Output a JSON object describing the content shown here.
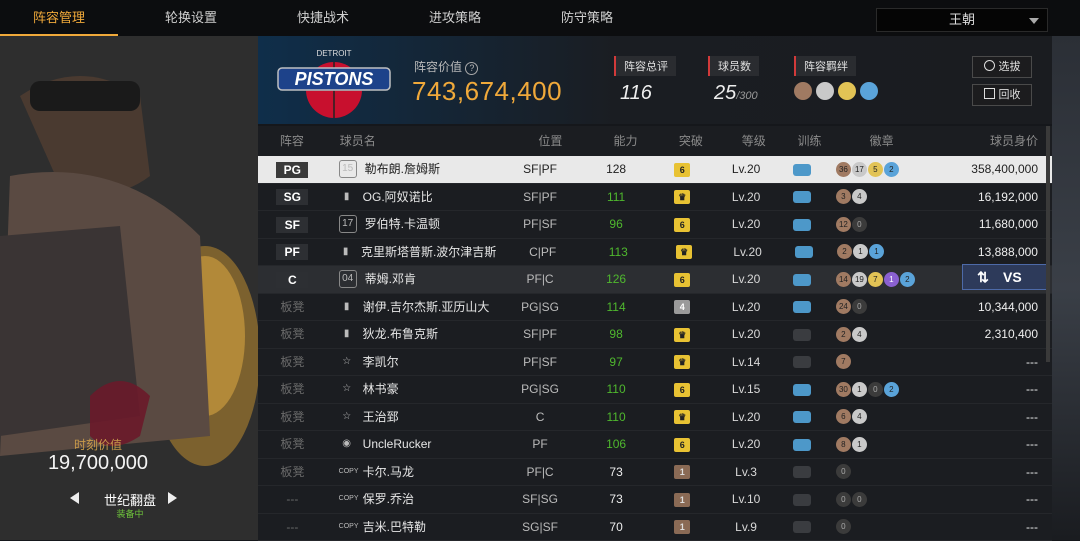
{
  "nav": {
    "tabs": [
      "阵容管理",
      "轮换设置",
      "快捷战术",
      "进攻策略",
      "防守策略"
    ],
    "team": "王朝"
  },
  "card": {
    "value_label": "时刻价值",
    "value": "19,700,000",
    "name": "世纪翻盘",
    "status": "装备中"
  },
  "header": {
    "lineup_value_label": "阵容价值",
    "lineup_value": "743,674,400",
    "overall_label": "阵容总评",
    "overall": "116",
    "players_label": "球员数",
    "players": "25",
    "players_max": "/300",
    "bond_label": "阵容羁绊",
    "select_btn": "选拔",
    "recycle_btn": "回收"
  },
  "columns": [
    "阵容",
    "球员名",
    "位置",
    "能力",
    "突破",
    "等级",
    "训练",
    "徽章",
    "球员身价"
  ],
  "rows": [
    {
      "slot": "PG",
      "icon": "15",
      "name": "勒布朗.詹姆斯",
      "pos": "SF|PF",
      "ability": "128",
      "abilColor": "white",
      "brk": "6",
      "brkType": "y",
      "lvl": "Lv.20",
      "train": "blue",
      "badges": [
        [
          "36",
          "br"
        ],
        [
          "17",
          "si"
        ],
        [
          "5",
          "go"
        ],
        [
          "2",
          "bl"
        ]
      ],
      "price": "358,400,000"
    },
    {
      "slot": "SG",
      "icon": "signal",
      "name": "OG.阿奴诺比",
      "pos": "SF|PF",
      "ability": "111",
      "abilColor": "green",
      "brk": "crown",
      "brkType": "y",
      "lvl": "Lv.20",
      "train": "blue",
      "badges": [
        [
          "3",
          "br"
        ],
        [
          "4",
          "si"
        ]
      ],
      "price": "16,192,000"
    },
    {
      "slot": "SF",
      "icon": "17",
      "name": "罗伯特.卡温顿",
      "pos": "PF|SF",
      "ability": "96",
      "abilColor": "green",
      "brk": "6",
      "brkType": "y",
      "lvl": "Lv.20",
      "train": "blue",
      "badges": [
        [
          "12",
          "br"
        ],
        [
          "0",
          "dk"
        ]
      ],
      "price": "11,680,000"
    },
    {
      "slot": "PF",
      "icon": "signal",
      "name": "克里斯塔普斯.波尔津吉斯",
      "pos": "C|PF",
      "ability": "113",
      "abilColor": "green",
      "brk": "crown",
      "brkType": "y",
      "lvl": "Lv.20",
      "train": "blue",
      "badges": [
        [
          "2",
          "br"
        ],
        [
          "1",
          "si"
        ],
        [
          "1",
          "bl"
        ]
      ],
      "price": "13,888,000"
    },
    {
      "slot": "C",
      "icon": "04",
      "name": "蒂姆.邓肯",
      "pos": "PF|C",
      "ability": "126",
      "abilColor": "green",
      "brk": "6",
      "brkType": "y",
      "lvl": "Lv.20",
      "train": "blue",
      "badges": [
        [
          "14",
          "br"
        ],
        [
          "19",
          "si"
        ],
        [
          "7",
          "go"
        ],
        [
          "1",
          "pu"
        ],
        [
          "2",
          "bl"
        ]
      ],
      "price": ""
    },
    {
      "slot": "板凳",
      "icon": "signal",
      "name": "谢伊.吉尔杰斯.亚历山大",
      "pos": "PG|SG",
      "ability": "114",
      "abilColor": "green",
      "brk": "4",
      "brkType": "g",
      "lvl": "Lv.20",
      "train": "blue",
      "badges": [
        [
          "24",
          "br"
        ],
        [
          "0",
          "dk"
        ]
      ],
      "price": "10,344,000"
    },
    {
      "slot": "板凳",
      "icon": "signal",
      "name": "狄龙.布鲁克斯",
      "pos": "SF|PF",
      "ability": "98",
      "abilColor": "green",
      "brk": "crown",
      "brkType": "y",
      "lvl": "Lv.20",
      "train": "dim",
      "badges": [
        [
          "2",
          "br"
        ],
        [
          "4",
          "si"
        ]
      ],
      "price": "2,310,400"
    },
    {
      "slot": "板凳",
      "icon": "star",
      "name": "李凯尔",
      "pos": "PF|SF",
      "ability": "97",
      "abilColor": "green",
      "brk": "crown",
      "brkType": "y",
      "lvl": "Lv.14",
      "train": "dim",
      "badges": [
        [
          "7",
          "br"
        ]
      ],
      "price": "---"
    },
    {
      "slot": "板凳",
      "icon": "star",
      "name": "林书豪",
      "pos": "PG|SG",
      "ability": "110",
      "abilColor": "green",
      "brk": "6",
      "brkType": "y",
      "lvl": "Lv.15",
      "train": "blue",
      "badges": [
        [
          "30",
          "br"
        ],
        [
          "1",
          "si"
        ],
        [
          "0",
          "dk"
        ],
        [
          "2",
          "bl"
        ]
      ],
      "price": "---"
    },
    {
      "slot": "板凳",
      "icon": "star",
      "name": "王治郅",
      "pos": "C",
      "ability": "110",
      "abilColor": "green",
      "brk": "crown",
      "brkType": "y",
      "lvl": "Lv.20",
      "train": "blue",
      "badges": [
        [
          "6",
          "br"
        ],
        [
          "4",
          "si"
        ]
      ],
      "price": "---"
    },
    {
      "slot": "板凳",
      "icon": "person",
      "name": "UncleRucker",
      "pos": "PF",
      "ability": "106",
      "abilColor": "green",
      "brk": "6",
      "brkType": "y",
      "lvl": "Lv.20",
      "train": "blue1",
      "badges": [
        [
          "8",
          "br"
        ],
        [
          "1",
          "si"
        ]
      ],
      "price": "---"
    },
    {
      "slot": "板凳",
      "icon": "COPY",
      "name": "卡尔.马龙",
      "pos": "PF|C",
      "ability": "73",
      "abilColor": "white",
      "brk": "1",
      "brkType": "b",
      "lvl": "Lv.3",
      "train": "dim",
      "badges": [
        [
          "0",
          "dk"
        ]
      ],
      "price": "---"
    },
    {
      "slot": "---",
      "icon": "COPY",
      "name": "保罗.乔治",
      "pos": "SF|SG",
      "ability": "73",
      "abilColor": "white",
      "brk": "1",
      "brkType": "b",
      "lvl": "Lv.10",
      "train": "dim",
      "badges": [
        [
          "0",
          "dk"
        ],
        [
          "0",
          "dk"
        ]
      ],
      "price": "---"
    },
    {
      "slot": "---",
      "icon": "COPY",
      "name": "吉米.巴特勒",
      "pos": "SG|SF",
      "ability": "70",
      "abilColor": "white",
      "brk": "1",
      "brkType": "b",
      "lvl": "Lv.9",
      "train": "dim",
      "badges": [
        [
          "0",
          "dk"
        ]
      ],
      "price": "---"
    }
  ],
  "vs_label": "VS"
}
